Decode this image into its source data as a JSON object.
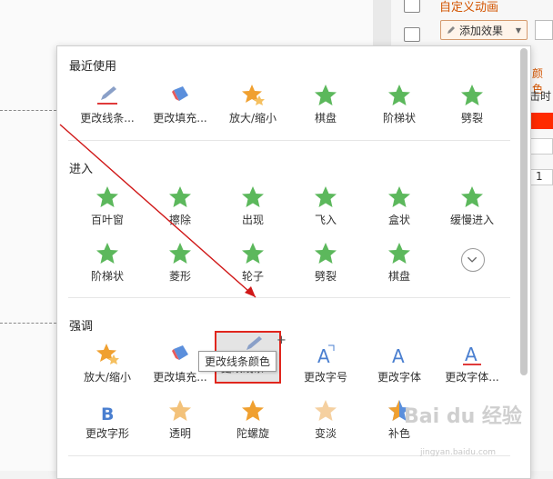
{
  "right_panel": {
    "title": "自定义动画",
    "add_effect_label": "添加效果",
    "text_color": "颜色",
    "text_time": "击时",
    "text_num": "1",
    "accent_red": "#ff2a00"
  },
  "popup": {
    "sections": {
      "recent": "最近使用",
      "enter": "进入",
      "emphasis": "强调"
    },
    "recent": [
      {
        "label": "更改线条...",
        "icon": "pencil-line-icon"
      },
      {
        "label": "更改填充...",
        "icon": "paint-bucket-icon"
      },
      {
        "label": "放大/缩小",
        "icon": "star-grow-icon"
      },
      {
        "label": "棋盘",
        "icon": "checker-star-icon"
      },
      {
        "label": "阶梯状",
        "icon": "stairs-star-icon"
      },
      {
        "label": "劈裂",
        "icon": "split-star-icon"
      }
    ],
    "enter": [
      {
        "label": "百叶窗",
        "icon": "blinds-star-icon"
      },
      {
        "label": "擦除",
        "icon": "wipe-star-icon"
      },
      {
        "label": "出现",
        "icon": "appear-star-icon"
      },
      {
        "label": "飞入",
        "icon": "fly-in-star-icon"
      },
      {
        "label": "盒状",
        "icon": "box-star-icon"
      },
      {
        "label": "缓慢进入",
        "icon": "slow-enter-star-icon"
      },
      {
        "label": "阶梯状",
        "icon": "stairs-star-icon"
      },
      {
        "label": "菱形",
        "icon": "diamond-star-icon"
      },
      {
        "label": "轮子",
        "icon": "wheel-star-icon"
      },
      {
        "label": "劈裂",
        "icon": "split-star-icon"
      },
      {
        "label": "棋盘",
        "icon": "checker-star-icon"
      }
    ],
    "emphasis": [
      {
        "label": "放大/缩小",
        "icon": "star-grow-icon"
      },
      {
        "label": "更改填充...",
        "icon": "paint-bucket-icon"
      },
      {
        "label": "更改线条...",
        "icon": "pencil-line-icon"
      },
      {
        "label": "更改字号",
        "icon": "font-size-icon"
      },
      {
        "label": "更改字体",
        "icon": "font-icon"
      },
      {
        "label": "更改字体...",
        "icon": "font-color-icon"
      },
      {
        "label": "更改字形",
        "icon": "font-style-icon"
      },
      {
        "label": "透明",
        "icon": "transparent-star-icon"
      },
      {
        "label": "陀螺旋",
        "icon": "spin-star-icon"
      },
      {
        "label": "变淡",
        "icon": "fade-star-icon"
      },
      {
        "label": "补色",
        "icon": "complement-star-icon"
      }
    ],
    "tooltip": "更改线条颜色"
  },
  "watermark": {
    "text": "Bai du 经验",
    "url": "jingyan.baidu.com"
  }
}
